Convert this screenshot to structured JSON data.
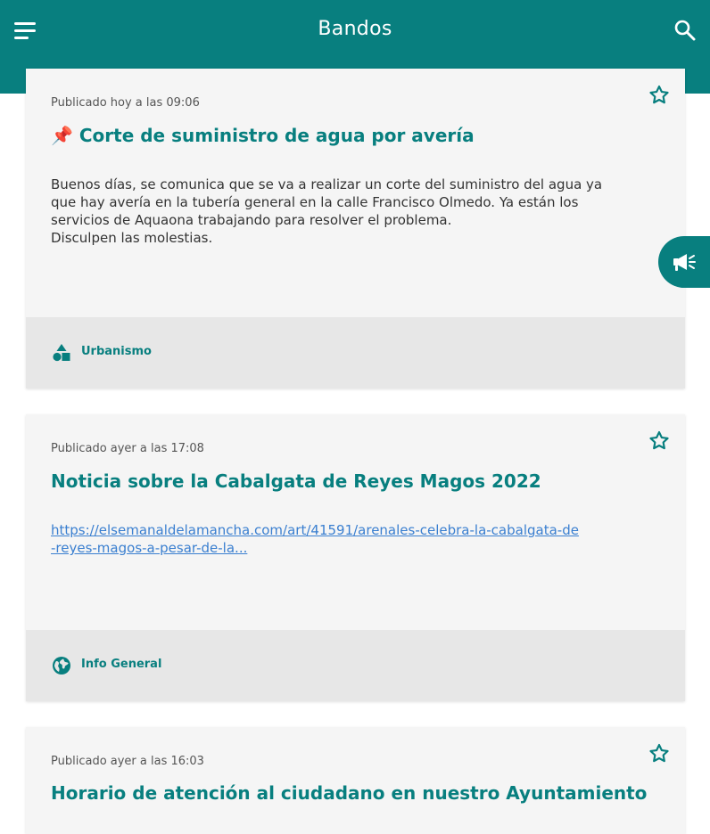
{
  "app": {
    "title": "Bandos",
    "accent_color": "#087f7f",
    "menu_icon": "hamburger-menu-icon",
    "search_icon": "search-icon",
    "fab_icon": "megaphone-icon"
  },
  "bandos": [
    {
      "published": "Publicado hoy a las 09:06",
      "pin": "📌",
      "title": "Corte de suministro de agua por avería",
      "body_lines": [
        "Buenos días, se comunica que se va a realizar un corte del suministro del agua ya",
        "que hay avería en la tubería general en la   calle Francisco Olmedo. Ya están los",
        "servicios de Aquaona trabajando para resolver el problema.",
        "Disculpen las molestias."
      ],
      "category": "Urbanismo",
      "category_icon": "shapes-icon"
    },
    {
      "published": "Publicado ayer a las 17:08",
      "title": "Noticia sobre la Cabalgata de Reyes Magos 2022",
      "link_lines": [
        "https://elsemanaldelamancha.com/art/41591/arenales-celebra-la-cabalgata-de",
        "-reyes-magos-a-pesar-de-la..."
      ],
      "category": "Info General",
      "category_icon": "globe-icon"
    },
    {
      "published": "Publicado ayer a las 16:03",
      "title": "Horario de atención al ciudadano en nuestro Ayuntamiento"
    }
  ]
}
